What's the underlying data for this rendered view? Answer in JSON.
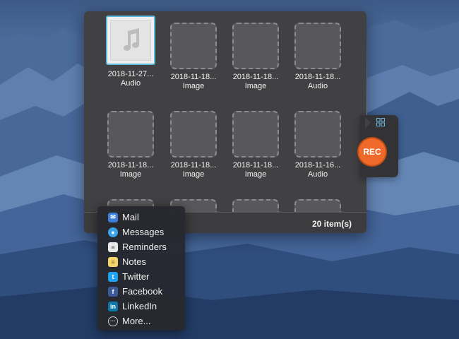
{
  "panel": {
    "items": [
      {
        "name": "2018-11-27...",
        "type": "Audio",
        "selected": true
      },
      {
        "name": "2018-11-18...",
        "type": "Image"
      },
      {
        "name": "2018-11-18...",
        "type": "Image"
      },
      {
        "name": "2018-11-18...",
        "type": "Audio"
      },
      {
        "name": "2018-11-18...",
        "type": "Image"
      },
      {
        "name": "2018-11-18...",
        "type": "Image"
      },
      {
        "name": "2018-11-18...",
        "type": "Image"
      },
      {
        "name": "2018-11-16...",
        "type": "Audio"
      }
    ],
    "item_count": "20 item(s)"
  },
  "recorder": {
    "rec_label": "REC",
    "accent_color": "#ef6a2a"
  },
  "share_menu": {
    "items": [
      {
        "label": "Mail",
        "icon": "mail-icon"
      },
      {
        "label": "Messages",
        "icon": "messages-icon"
      },
      {
        "label": "Reminders",
        "icon": "reminders-icon"
      },
      {
        "label": "Notes",
        "icon": "notes-icon"
      },
      {
        "label": "Twitter",
        "icon": "twitter-icon"
      },
      {
        "label": "Facebook",
        "icon": "facebook-icon"
      },
      {
        "label": "LinkedIn",
        "icon": "linkedin-icon"
      },
      {
        "label": "More...",
        "icon": "more-icon"
      }
    ]
  }
}
